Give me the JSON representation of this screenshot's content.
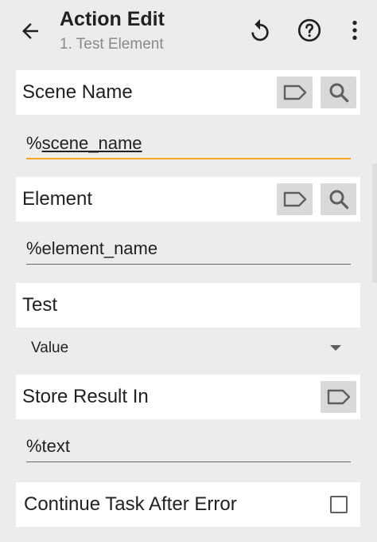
{
  "appbar": {
    "title": "Action Edit",
    "subtitle": "1. Test Element",
    "back_icon": "arrow-back-icon",
    "undo_icon": "undo-icon",
    "help_icon": "help-circle-icon",
    "more_icon": "more-vertical-icon"
  },
  "scene": {
    "label": "Scene Name",
    "value_prefix": "%",
    "value_main": "scene_name",
    "tag_icon": "variable-tag-icon",
    "search_icon": "search-icon"
  },
  "element": {
    "label": "Element",
    "value": "%element_name",
    "tag_icon": "variable-tag-icon",
    "search_icon": "search-icon"
  },
  "test": {
    "label": "Test",
    "selected": "Value"
  },
  "store": {
    "label": "Store Result In",
    "value": "%text",
    "tag_icon": "variable-tag-icon"
  },
  "continue": {
    "label": "Continue Task After Error",
    "checked": false
  },
  "colors": {
    "background": "#ececec",
    "card": "#ffffff",
    "accent_underline": "#f5a623",
    "button_bg": "#d9d9d9",
    "icon": "#5f5f5f"
  }
}
